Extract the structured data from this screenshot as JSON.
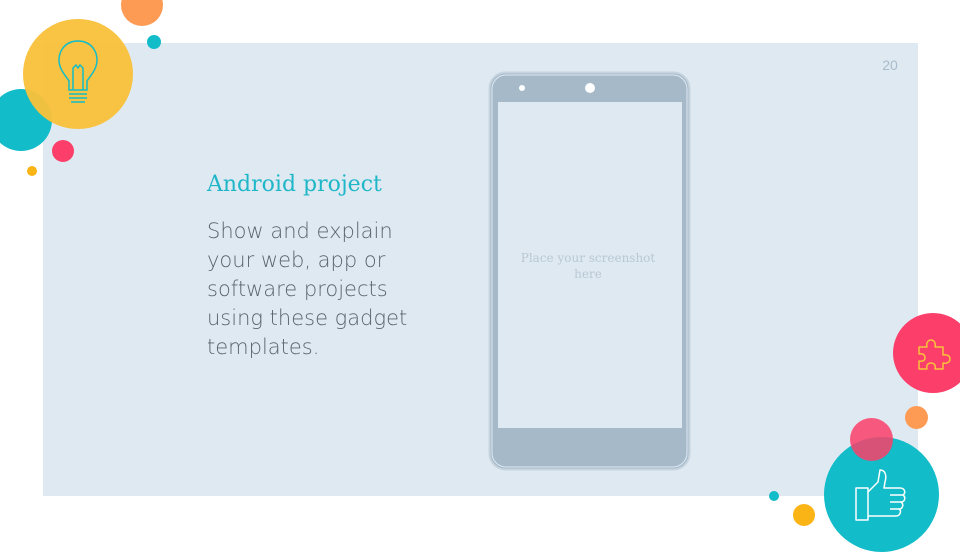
{
  "slide": {
    "page_number": "20",
    "title": "Android project",
    "body": "Show and explain your web, app or software projects using these gadget templates."
  },
  "device": {
    "type": "android-phone",
    "screen_placeholder": "Place your screenshot here"
  },
  "decorations": {
    "icons": [
      "lightbulb-icon",
      "puzzle-piece-icon",
      "thumbs-up-icon"
    ],
    "colors": {
      "yellow": "#f9c13b",
      "teal": "#12bcc8",
      "pink": "#fb3f6a",
      "orange": "#fd9b54",
      "gold": "#fbb416",
      "panel": "#dfe9f2",
      "phone_body": "#a5b9c8",
      "title": "#1fb7c8"
    }
  }
}
